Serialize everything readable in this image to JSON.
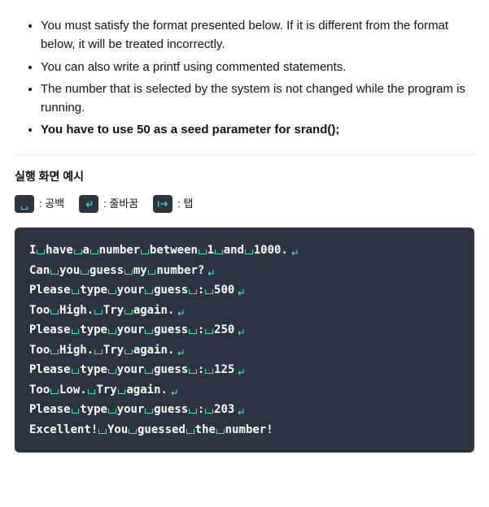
{
  "requirements": [
    "You must satisfy the format presented below. If it is different from the format below, it will be treated incorrectly.",
    "You can also write a printf using commented statements.",
    "The number that is selected by the system is not changed while the program is running.",
    "You have to use 50 as a seed parameter for srand();"
  ],
  "section_title": "실행 화면 예시",
  "legend": {
    "space": ": 공백",
    "newline": ": 줄바꿈",
    "tab": ": 탭"
  },
  "console_lines": [
    [
      {
        "t": "I"
      },
      {
        "s": true
      },
      {
        "t": "have"
      },
      {
        "s": true
      },
      {
        "t": "a"
      },
      {
        "s": true
      },
      {
        "t": "number"
      },
      {
        "s": true
      },
      {
        "t": "between"
      },
      {
        "s": true
      },
      {
        "t": "1"
      },
      {
        "s": true
      },
      {
        "t": "and"
      },
      {
        "s": true
      },
      {
        "t": "1000."
      },
      {
        "n": true
      }
    ],
    [
      {
        "t": "Can"
      },
      {
        "s": true
      },
      {
        "t": "you"
      },
      {
        "s": true
      },
      {
        "t": "guess"
      },
      {
        "s": true
      },
      {
        "t": "my"
      },
      {
        "s": true
      },
      {
        "t": "number?"
      },
      {
        "n": true
      }
    ],
    [
      {
        "t": "Please"
      },
      {
        "s": true
      },
      {
        "t": "type"
      },
      {
        "s": true
      },
      {
        "t": "your"
      },
      {
        "s": true
      },
      {
        "t": "guess"
      },
      {
        "s": true
      },
      {
        "t": ":"
      },
      {
        "s": true
      },
      {
        "t": "500"
      },
      {
        "n": true
      }
    ],
    [
      {
        "t": "Too"
      },
      {
        "s": true
      },
      {
        "t": "High."
      },
      {
        "s": true
      },
      {
        "t": "Try"
      },
      {
        "s": true
      },
      {
        "t": "again."
      },
      {
        "n": true
      }
    ],
    [
      {
        "t": "Please"
      },
      {
        "s": true
      },
      {
        "t": "type"
      },
      {
        "s": true
      },
      {
        "t": "your"
      },
      {
        "s": true
      },
      {
        "t": "guess"
      },
      {
        "s": true
      },
      {
        "t": ":"
      },
      {
        "s": true
      },
      {
        "t": "250"
      },
      {
        "n": true
      }
    ],
    [
      {
        "t": "Too"
      },
      {
        "s": true
      },
      {
        "t": "High."
      },
      {
        "s": true
      },
      {
        "t": "Try"
      },
      {
        "s": true
      },
      {
        "t": "again."
      },
      {
        "n": true
      }
    ],
    [
      {
        "t": "Please"
      },
      {
        "s": true
      },
      {
        "t": "type"
      },
      {
        "s": true
      },
      {
        "t": "your"
      },
      {
        "s": true
      },
      {
        "t": "guess"
      },
      {
        "s": true
      },
      {
        "t": ":"
      },
      {
        "s": true
      },
      {
        "t": "125"
      },
      {
        "n": true
      }
    ],
    [
      {
        "t": "Too"
      },
      {
        "s": true
      },
      {
        "t": "Low."
      },
      {
        "s": true
      },
      {
        "t": "Try"
      },
      {
        "s": true
      },
      {
        "t": "again."
      },
      {
        "n": true
      }
    ],
    [
      {
        "t": "Please"
      },
      {
        "s": true
      },
      {
        "t": "type"
      },
      {
        "s": true
      },
      {
        "t": "your"
      },
      {
        "s": true
      },
      {
        "t": "guess"
      },
      {
        "s": true
      },
      {
        "t": ":"
      },
      {
        "s": true
      },
      {
        "t": "203"
      },
      {
        "n": true
      }
    ],
    [
      {
        "t": "Excellent!"
      },
      {
        "s": true
      },
      {
        "t": "You"
      },
      {
        "s": true
      },
      {
        "t": "guessed"
      },
      {
        "s": true
      },
      {
        "t": "the"
      },
      {
        "s": true
      },
      {
        "t": "number!"
      }
    ]
  ]
}
